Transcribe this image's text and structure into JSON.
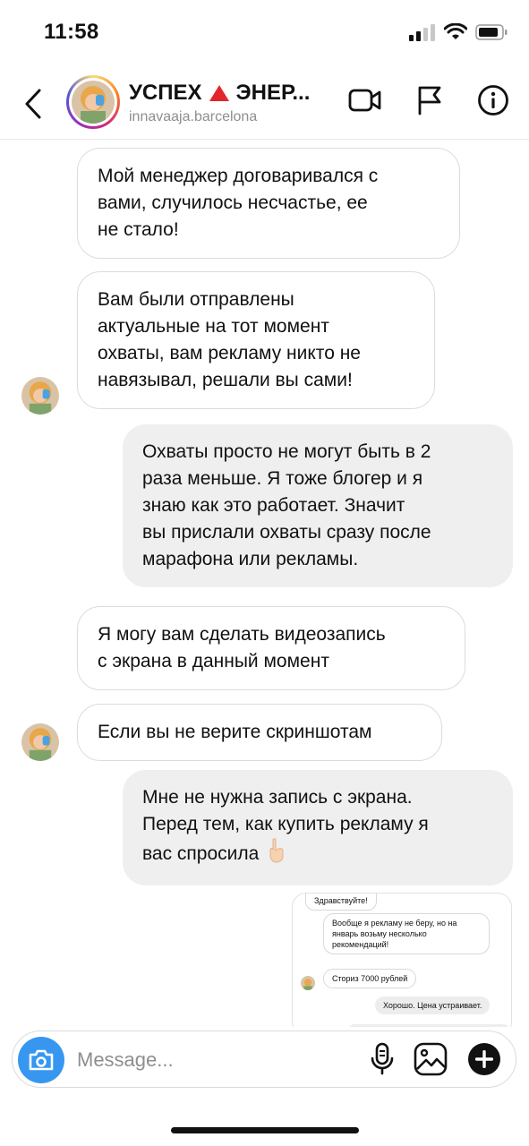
{
  "status": {
    "time": "11:58"
  },
  "header": {
    "title_part1": "УСПЕХ",
    "title_part2": "ЭНЕР...",
    "subtitle": "innavaaja.barcelona"
  },
  "messages": [
    {
      "side": "in",
      "text": "Мой менеджер договаривался с\nвами, случилось несчастье, ее\nне стало!"
    },
    {
      "side": "in",
      "text": "Вам были отправлены\nактуальные на тот момент\nохваты, вам рекламу никто не\nнавязывал, решали вы сами!"
    },
    {
      "side": "out",
      "text": "Охваты просто не могут быть в 2\nраза меньше. Я тоже блогер и я\nзнаю как это работает. Значит\nвы прислали охваты сразу после\nмарафона или рекламы."
    },
    {
      "side": "in",
      "text": "Я могу вам сделать видеозапись\nс экрана в данный момент"
    },
    {
      "side": "in",
      "text": "Если вы не верите скриншотам"
    },
    {
      "side": "out",
      "text": "Мне не нужна запись с экрана.\nПеред тем, как купить рекламу я\nвас спросила"
    }
  ],
  "embedded_screenshot": {
    "m1": "Здравствуйте!",
    "m2": "Вообще я рекламу не беру, но на\nянварь возьму несколько\nрекомендаций!",
    "m3": "Сториз 7000 рублей",
    "m4": "Хорошо. Цена устраивает."
  },
  "composer": {
    "placeholder": "Message..."
  },
  "colors": {
    "accent": "#3797f0",
    "warning": "#e3262c",
    "out_bubble": "#efefef"
  }
}
